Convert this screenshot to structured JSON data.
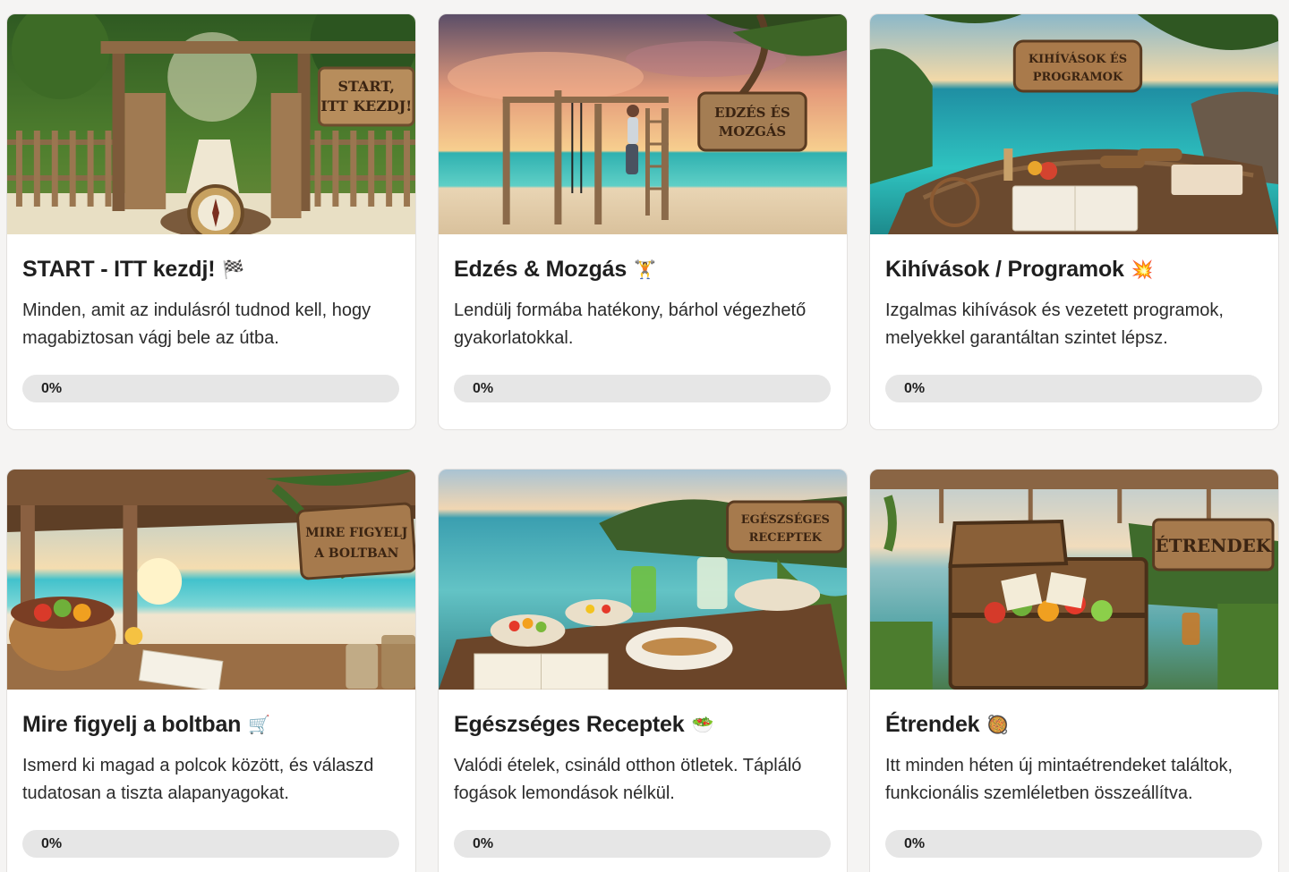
{
  "cards": [
    {
      "title": "START - ITT kezdj!",
      "emoji": "🏁",
      "description": "Minden, amit az indulásról tudnod kell, hogy magabiztosan vágj bele az útba.",
      "progress": 0,
      "progress_label": "0%",
      "image_sign": [
        "START,",
        "ITT KEZDJ!"
      ],
      "image_subject": "jungle gate with compass"
    },
    {
      "title": "Edzés & Mozgás",
      "emoji": "🏋",
      "description": "Lendülj formába hatékony, bárhol végezhető gyakorlatokkal.",
      "progress": 0,
      "progress_label": "0%",
      "image_sign": [
        "EDZÉS ÉS",
        "MOZGÁS"
      ],
      "image_subject": "beach workout frame at sunset"
    },
    {
      "title": "Kihívások / Programok",
      "emoji": "💥",
      "description": "Izgalmas kihívások és vezetett programok, melyekkel garantáltan szintet lépsz.",
      "progress": 0,
      "progress_label": "0%",
      "image_sign": [
        "KIHÍVÁSOK ÉS",
        "PROGRAMOK"
      ],
      "image_subject": "rock table with dumbbells and planner"
    },
    {
      "title": "Mire figyelj a boltban",
      "emoji": "🛒",
      "description": "Ismerd ki magad a polcok között, és válaszd tudatosan a tiszta alapanyagokat.",
      "progress": 0,
      "progress_label": "0%",
      "image_sign": [
        "MIRE FIGYELJ",
        "A BOLTBAN"
      ],
      "image_subject": "beach hut with produce basket"
    },
    {
      "title": "Egészséges Receptek",
      "emoji": "🥗",
      "description": "Valódi ételek, csináld otthon ötletek. Tápláló fogások lemondások nélkül.",
      "progress": 0,
      "progress_label": "0%",
      "image_sign": [
        "EGÉSZSÉGES",
        "RECEPTEK"
      ],
      "image_subject": "seaside table with healthy dishes"
    },
    {
      "title": "Étrendek",
      "emoji": "🥘",
      "description": "Itt minden héten új mintaétrendeket találtok, funkcionális szemléletben összeállítva.",
      "progress": 0,
      "progress_label": "0%",
      "image_sign": [
        "ÉTRENDEK"
      ],
      "image_subject": "treasure chest with vegetables"
    }
  ],
  "colors": {
    "page_bg": "#f5f4f3",
    "card_bg": "#ffffff",
    "progress_track": "#e6e6e6",
    "progress_fill": "#8ccf6f"
  }
}
